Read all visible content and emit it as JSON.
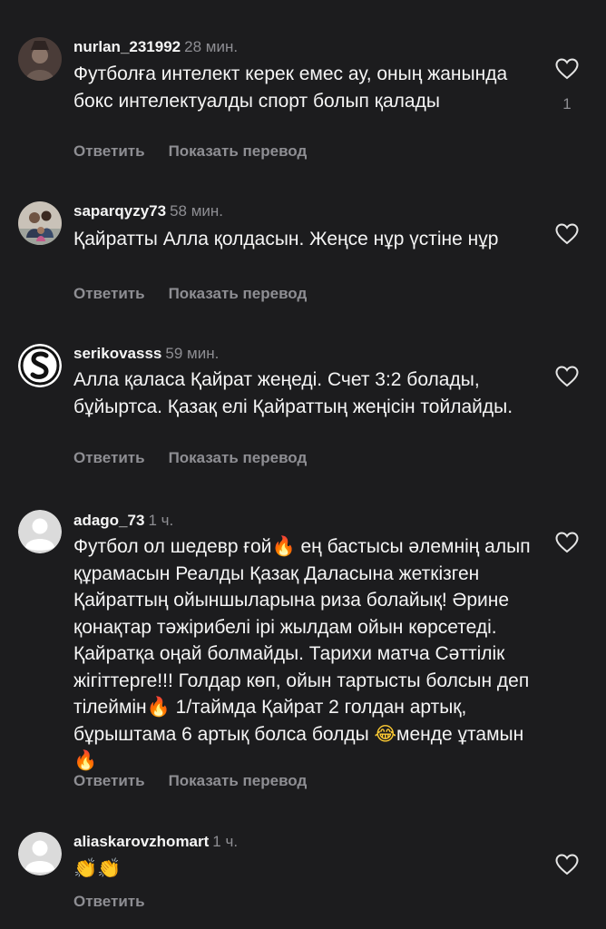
{
  "comments": [
    {
      "username": "nurlan_231992",
      "time": "28 мин.",
      "text": "Футболға интелект керек емес ау,  оның жанында бокс интелектуалды спорт болып қалады",
      "like_count": "1",
      "reply_label": "Ответить",
      "translate_label": "Показать перевод"
    },
    {
      "username": "saparqyzy73",
      "time": "58 мин.",
      "text": "Қайратты Алла қолдасын. Жеңсе нұр үстіне нұр",
      "reply_label": "Ответить",
      "translate_label": "Показать перевод"
    },
    {
      "username": "serikovasss",
      "time": "59 мин.",
      "text": "Алла қаласа Қайрат жеңеді. Счет 3:2 болады, бұйыртса. Қазақ елі Қайраттың жеңісін тойлайды.",
      "reply_label": "Ответить",
      "translate_label": "Показать перевод"
    },
    {
      "username": "adago_73",
      "time": "1 ч.",
      "text_parts": [
        "Футбол  ол шедевр ғой",
        "🔥",
        "  ең бастысы әлемнің алып құрамасын Реалды Қазақ Даласына жеткізген Қайраттың ойыншыларына риза болайық! Әрине қонақтар тәжірибелі ірі жылдам ойын көрсетеді. Қайратқа оңай болмайды. Тарихи матча Сәттілік жігіттерге!!! Голдар көп, ойын тартысты болсын деп тілеймін",
        "🔥",
        "  1/таймда Қайрат 2 голдан артық, бұрыштама 6 артық болса болды ",
        "😂",
        "менде ұтамын",
        "🔥"
      ],
      "reply_label": "Ответить",
      "translate_label": "Показать перевод"
    },
    {
      "username": "aliaskarovzhomart",
      "time": "1 ч.",
      "text": "👏👏",
      "reply_label": "Ответить"
    }
  ],
  "colors": {
    "background": "#1c1c1e",
    "text": "#f5f5f5",
    "secondary": "#8e8e93",
    "fire": "#ff6a00"
  },
  "icons": {
    "like": "heart-outline-icon",
    "default_avatar": "user-silhouette-icon"
  }
}
